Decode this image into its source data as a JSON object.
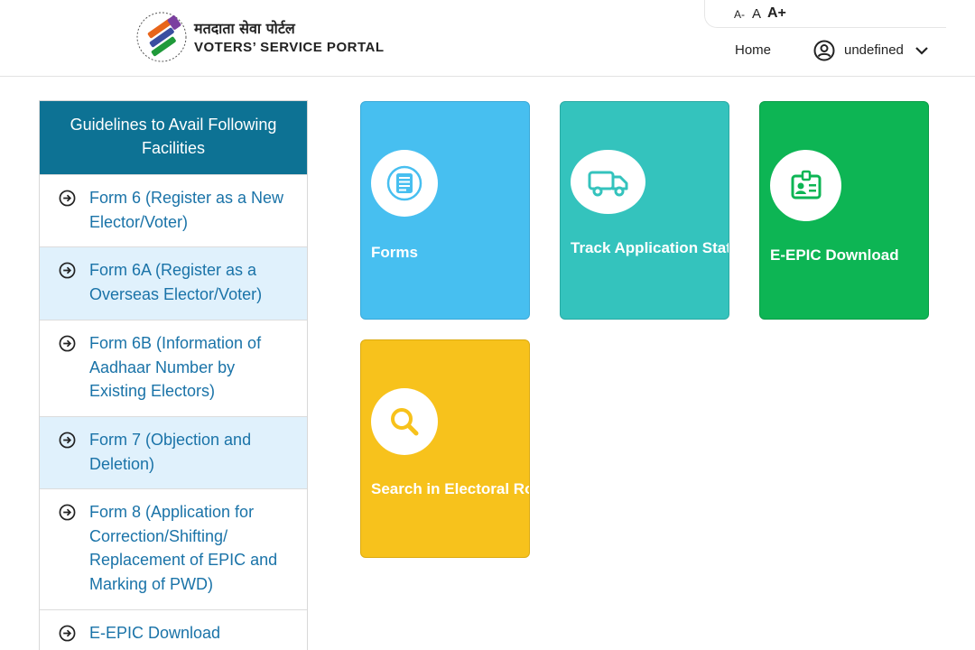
{
  "header": {
    "brand_hindi": "मतदाता सेवा पोर्टल",
    "brand_english": "VOTERS’ SERVICE PORTAL",
    "font_controls": [
      "A-",
      "A",
      "A+"
    ],
    "nav_home": "Home",
    "user_name": "undefined"
  },
  "sidebar": {
    "heading": "Guidelines to Avail Following Facilities",
    "items": [
      {
        "label": "Form 6 (Register as a New Elector/Voter)"
      },
      {
        "label": "Form 6A (Register as a Overseas Elector/Voter)"
      },
      {
        "label": "Form 6B (Information of Aadhaar Number by Existing Electors)"
      },
      {
        "label": "Form 7 (Objection and Deletion)"
      },
      {
        "label": "Form 8 (Application for Correction/Shifting/ Replacement of EPIC and Marking of PWD)"
      },
      {
        "label": "E-EPIC Download"
      }
    ]
  },
  "tiles": [
    {
      "label": "Forms",
      "icon": "document-list-icon",
      "color": "#47bff0"
    },
    {
      "label": "Track Application Stat",
      "icon": "truck-icon",
      "color": "#34c3bd"
    },
    {
      "label": "E-EPIC Download",
      "icon": "id-card-icon",
      "color": "#0db554"
    },
    {
      "label": "Search in Electoral Rol",
      "icon": "search-icon",
      "color": "#f7c21c"
    }
  ],
  "colors": {
    "sidebar_header": "#0d7294",
    "link": "#1a73a8",
    "alt_row": "#e0f1fc"
  }
}
